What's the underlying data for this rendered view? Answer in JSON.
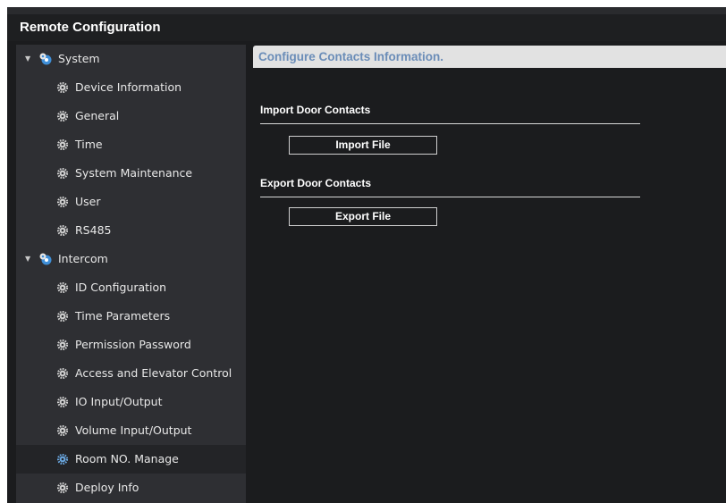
{
  "window": {
    "title": "Remote Configuration"
  },
  "sidebar": {
    "groups": [
      {
        "label": "System",
        "expanded": true,
        "items": [
          {
            "label": "Device Information"
          },
          {
            "label": "General"
          },
          {
            "label": "Time"
          },
          {
            "label": "System Maintenance"
          },
          {
            "label": "User"
          },
          {
            "label": "RS485"
          }
        ]
      },
      {
        "label": "Intercom",
        "expanded": true,
        "items": [
          {
            "label": "ID Configuration"
          },
          {
            "label": "Time Parameters"
          },
          {
            "label": "Permission Password"
          },
          {
            "label": "Access and Elevator Control"
          },
          {
            "label": "IO Input/Output"
          },
          {
            "label": "Volume Input/Output"
          },
          {
            "label": "Room NO. Manage",
            "selected": true
          },
          {
            "label": "Deploy Info"
          }
        ]
      }
    ]
  },
  "content": {
    "header": "Configure Contacts Information.",
    "import_section": {
      "title": "Import Door Contacts",
      "button_label": "Import File"
    },
    "export_section": {
      "title": "Export Door Contacts",
      "button_label": "Export File"
    }
  },
  "colors": {
    "window_background": "#1b1c1e",
    "sidebar_background": "#2e2f33",
    "selected_item_background": "#232427",
    "header_background": "#e2e2e2",
    "header_text": "#6b8db8",
    "gear_icon": "#d0d0d0",
    "selected_gear_icon": "#6aa7e0",
    "group_icon_blue": "#3f8fd8"
  },
  "icons": {
    "expand": "triangle-down-icon",
    "group": "gear-cluster-icon",
    "leaf": "gear-icon"
  }
}
